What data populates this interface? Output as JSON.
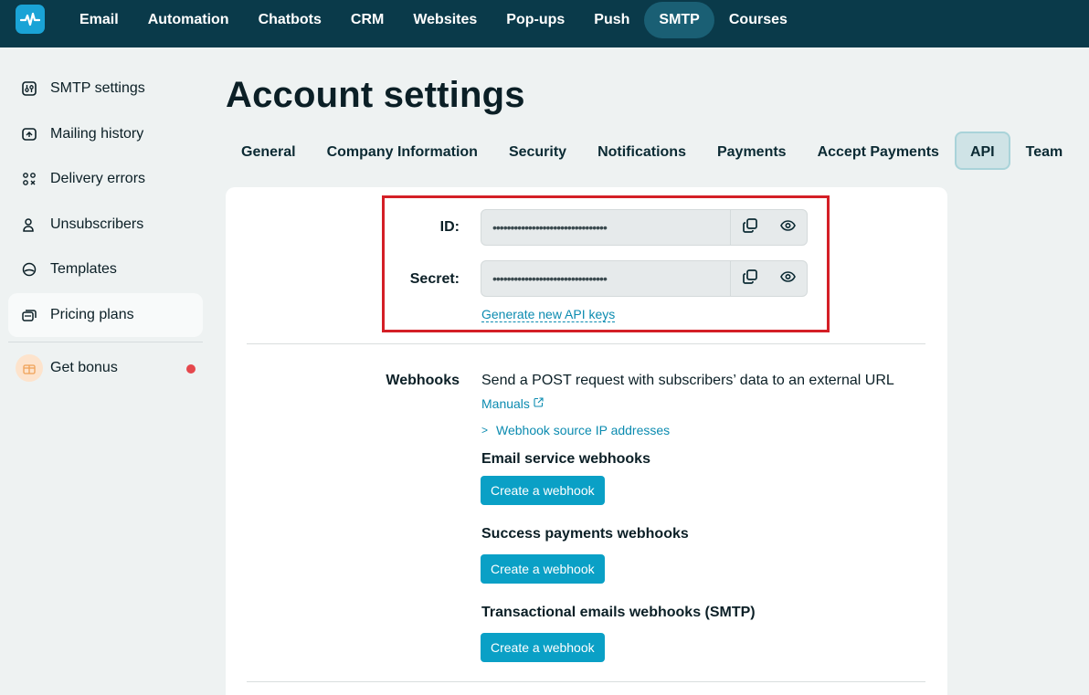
{
  "topnav": {
    "items": [
      "Email",
      "Automation",
      "Chatbots",
      "CRM",
      "Websites",
      "Pop-ups",
      "Push",
      "SMTP",
      "Courses"
    ],
    "active": "SMTP",
    "bg_color": "#0a3a4a",
    "active_color": "#1a5f74"
  },
  "sidebar": {
    "items": [
      {
        "label": "SMTP settings",
        "icon": "sliders-icon"
      },
      {
        "label": "Mailing history",
        "icon": "mail-history-icon"
      },
      {
        "label": "Delivery errors",
        "icon": "delivery-errors-icon"
      },
      {
        "label": "Unsubscribers",
        "icon": "unsubscriber-icon"
      },
      {
        "label": "Templates",
        "icon": "templates-icon"
      },
      {
        "label": "Pricing plans",
        "icon": "pricing-icon"
      }
    ],
    "active": "Pricing plans",
    "bonus": {
      "label": "Get bonus",
      "icon": "gift-icon"
    }
  },
  "page": {
    "title": "Account settings",
    "tabs": [
      "General",
      "Company Information",
      "Security",
      "Notifications",
      "Payments",
      "Accept Payments",
      "API",
      "Team"
    ],
    "active_tab": "API"
  },
  "api": {
    "id_label": "ID:",
    "id_value": "••••••••••••••••••••••••••••••••",
    "secret_label": "Secret:",
    "secret_value": "••••••••••••••••••••••••••••••••",
    "generate_link": "Generate new API keys",
    "highlight_color": "#d41f26"
  },
  "webhooks": {
    "label": "Webhooks",
    "description": "Send a POST request with subscribers’ data to an external URL",
    "manuals_link": "Manuals",
    "ip_link": "Webhook source IP addresses",
    "ip_chevron": ">",
    "sections": [
      {
        "title": "Email service webhooks",
        "button": "Create a webhook"
      },
      {
        "title": "Success payments webhooks",
        "button": "Create a webhook"
      },
      {
        "title": "Transactional emails webhooks (SMTP)",
        "button": "Create a webhook"
      }
    ],
    "button_color": "#0aa0c6",
    "link_color": "#0b8bb0"
  }
}
